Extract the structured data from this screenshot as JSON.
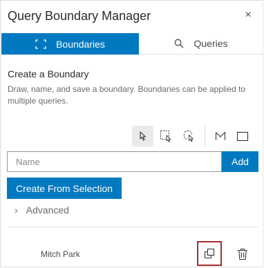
{
  "window": {
    "title": "Query Boundary Manager",
    "close_label": "×"
  },
  "tabs": [
    {
      "label": "Boundaries",
      "icon": "boundary-icon",
      "active": true
    },
    {
      "label": "Queries",
      "icon": "search-icon",
      "active": false
    }
  ],
  "create": {
    "heading": "Create a Boundary",
    "description": "Draw, name, and save a boundary. Boundaries can be applied to multiple queries."
  },
  "toolbar": {
    "tools": [
      "select-pointer-icon",
      "rectangle-select-icon",
      "lasso-select-icon",
      "polyline-icon",
      "rectangle-icon"
    ],
    "active_tool": "select-pointer-icon"
  },
  "name_input": {
    "placeholder": "Name",
    "value": ""
  },
  "buttons": {
    "add": "Add",
    "create_from_selection": "Create From Selection"
  },
  "advanced": {
    "label": "Advanced",
    "chevron": "›"
  },
  "boundaries": [
    {
      "name": "Mitch Park"
    }
  ],
  "colors": {
    "accent": "#0079c1",
    "focus_outline": "#a32b2b"
  }
}
